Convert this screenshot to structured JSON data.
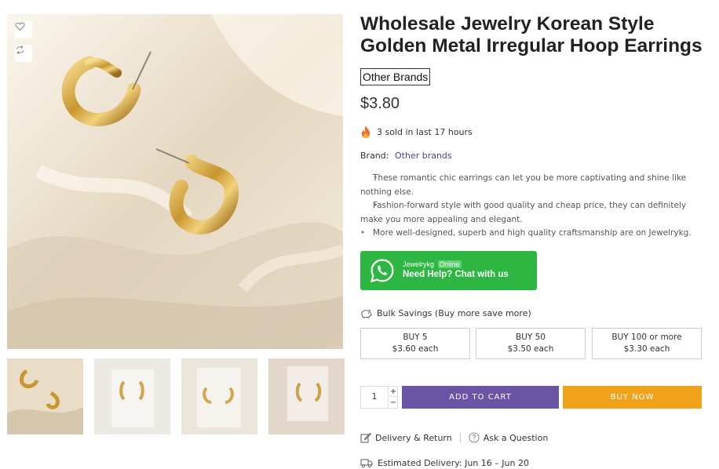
{
  "product": {
    "title": "Wholesale Jewelry Korean Style Golden Metal Irregular Hoop Earrings",
    "brand_tag": "Other Brands",
    "price": "$3.80",
    "sold_text": "3 sold in last 17 hours",
    "brand_label": "Brand:",
    "brand_value": "Other brands",
    "features": [
      "These romantic chic earrings can let you be more captivating and shine like nothing else.",
      "Fashion-forward style with good quality and cheap price, they can definitely make you more appealing and elegant.",
      "More well-designed, superb and high quality craftsmanship are on Jewelrykg."
    ]
  },
  "gallery": {
    "wishlist_icon": "heart-icon",
    "compare_icon": "compare-arrows-icon",
    "thumbnails": [
      "earring-thumb-1",
      "earring-thumb-2",
      "earring-thumb-3",
      "earring-thumb-4"
    ]
  },
  "whatsapp": {
    "name": "Jewelrykg",
    "status": "Online",
    "cta": "Need Help? Chat with us",
    "color": "#2db742"
  },
  "bulk": {
    "heading": "Bulk Savings (Buy more save more)",
    "tiers": [
      {
        "label": "BUY 5",
        "price": "$3.60 each"
      },
      {
        "label": "BUY 50",
        "price": "$3.50 each"
      },
      {
        "label": "BUY 100 or more",
        "price": "$3.30 each"
      }
    ]
  },
  "cart": {
    "quantity": "1",
    "plus": "+",
    "minus": "−",
    "add_to_cart": "ADD TO CART",
    "buy_now": "BUY NOW",
    "add_color": "#6a55a4",
    "buy_color": "#f0a21a"
  },
  "links": {
    "delivery": "Delivery & Return",
    "ask": "Ask a Question"
  },
  "estimated_delivery": "Estimated Delivery: Jun 16 – Jun 20"
}
